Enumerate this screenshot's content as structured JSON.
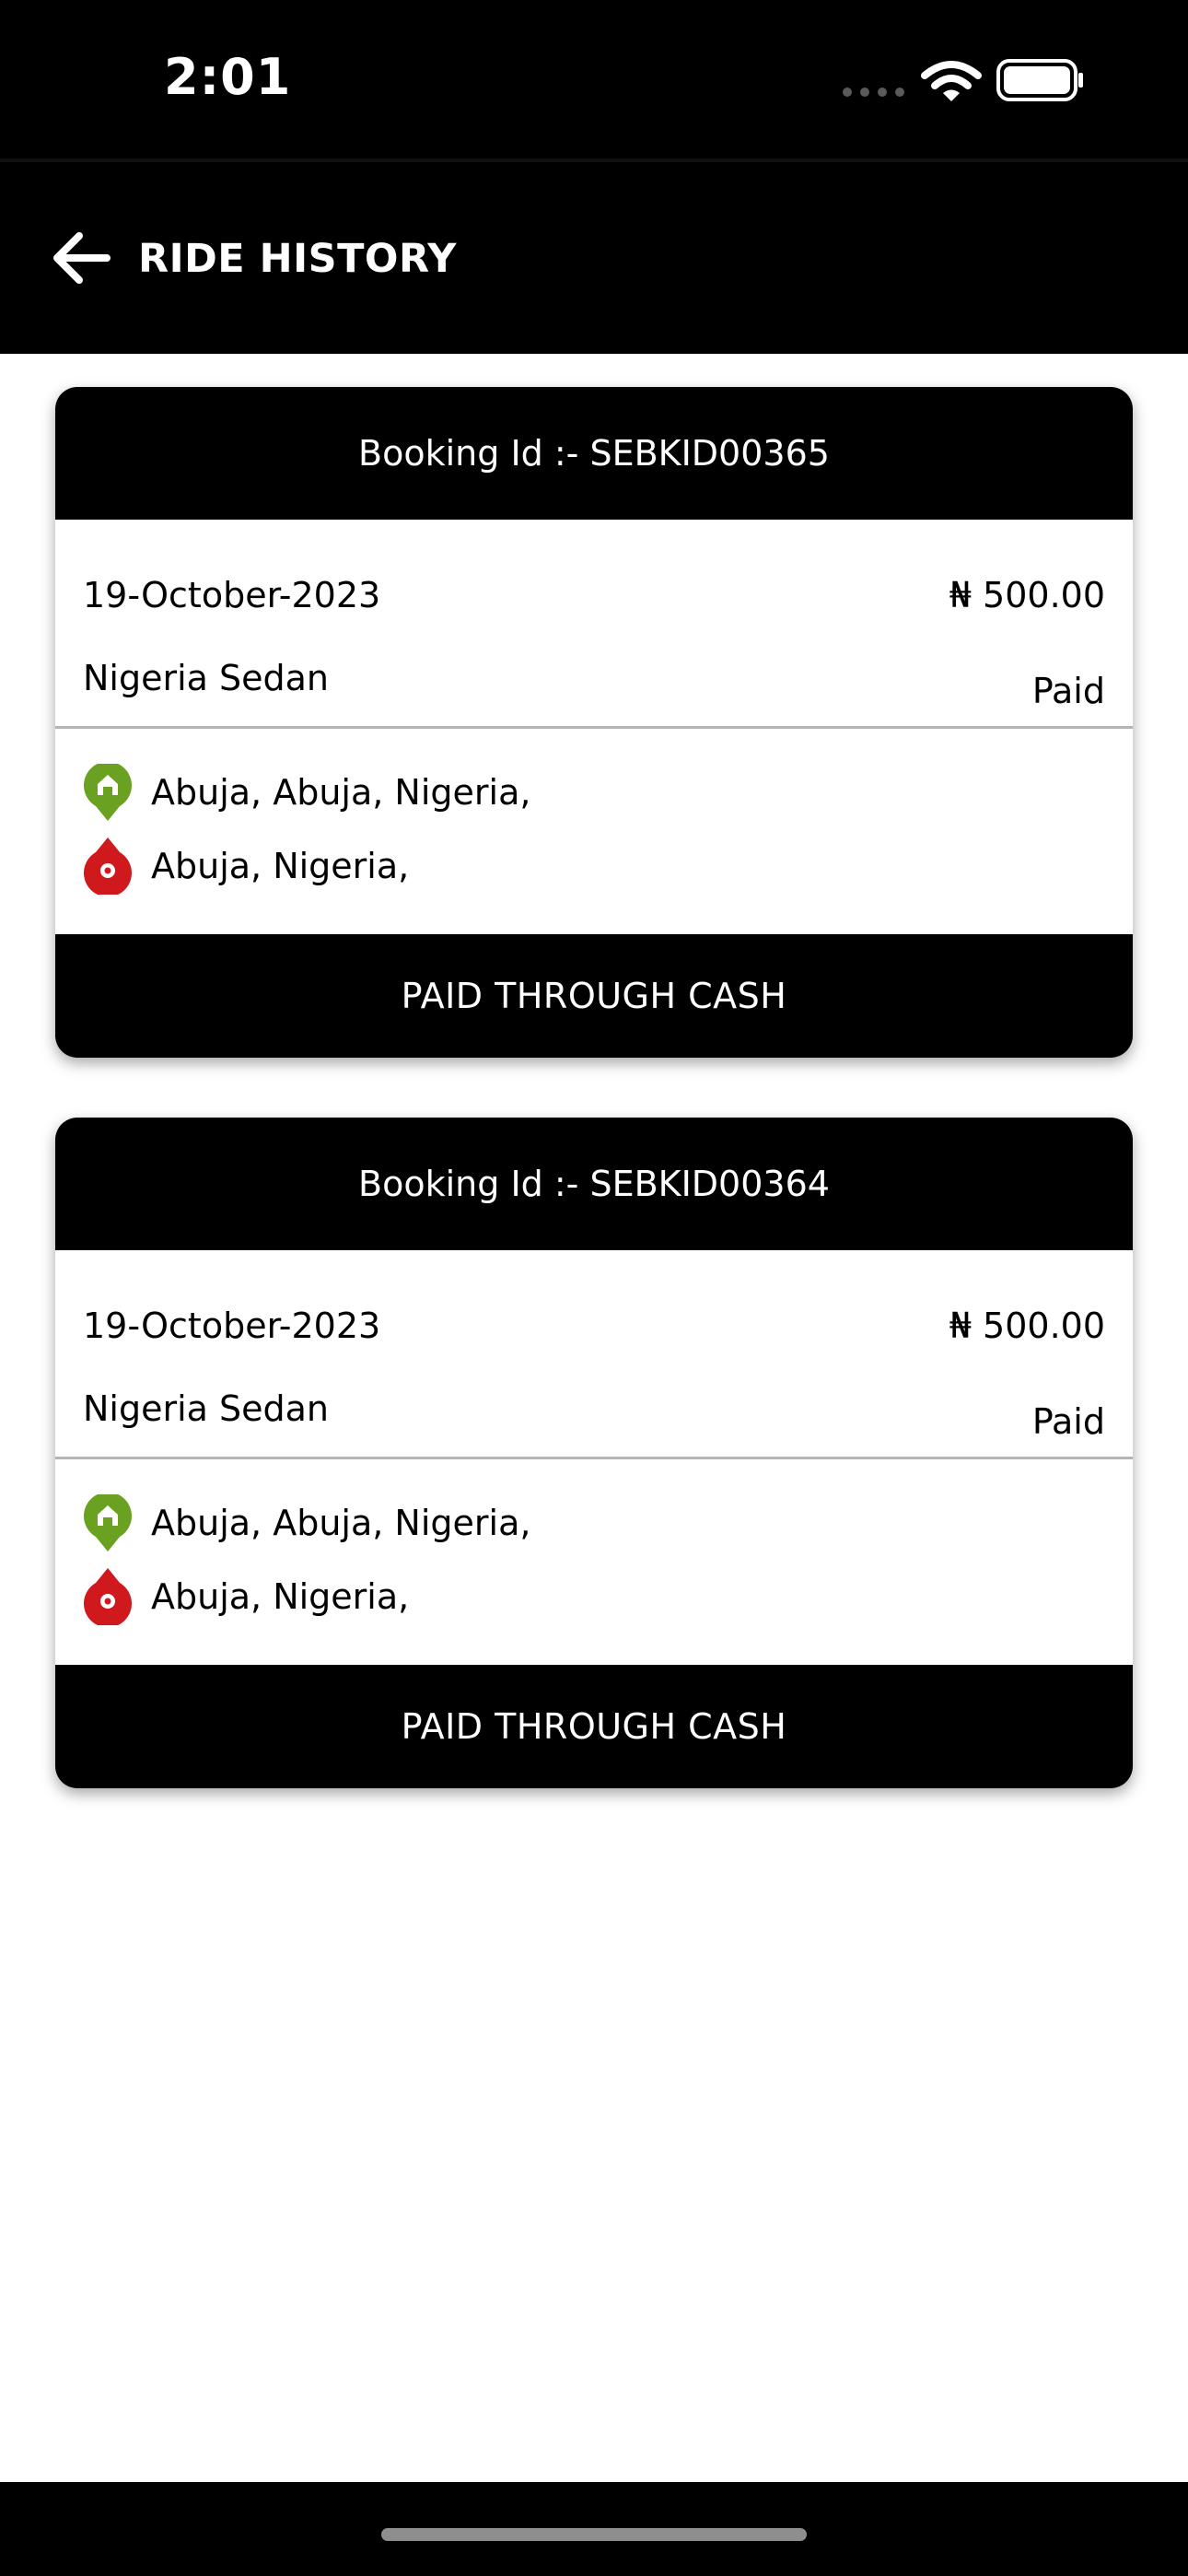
{
  "status_bar": {
    "time": "2:01",
    "icons": [
      "signal-dots-icon",
      "wifi-icon",
      "battery-icon"
    ]
  },
  "header": {
    "back_icon": "arrow-left-icon",
    "title": "RIDE HISTORY"
  },
  "colors": {
    "background": "#ffffff",
    "header_bg": "#000000",
    "pickup_pin": "#6aa121",
    "drop_pin": "#d0191c",
    "divider": "#b5b5b5"
  },
  "rides": [
    {
      "booking_id": "Booking Id :- SEBKID00365",
      "date": "19-October-2023",
      "vehicle": "Nigeria Sedan",
      "amount": "₦ 500.00",
      "status": "Paid",
      "pickup": "Abuja, Abuja, Nigeria,",
      "drop": "Abuja, Nigeria,",
      "payment": "PAID THROUGH CASH"
    },
    {
      "booking_id": "Booking Id :- SEBKID00364",
      "date": "19-October-2023",
      "vehicle": "Nigeria Sedan",
      "amount": "₦ 500.00",
      "status": "Paid",
      "pickup": "Abuja, Abuja, Nigeria,",
      "drop": "Abuja, Nigeria,",
      "payment": "PAID THROUGH CASH"
    }
  ]
}
